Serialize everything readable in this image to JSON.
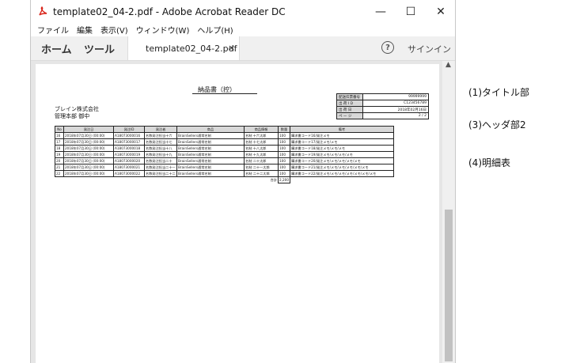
{
  "window": {
    "title": "template02_04-2.pdf - Adobe Acrobat Reader DC",
    "minimize": "—",
    "maximize": "☐",
    "close": "✕"
  },
  "menu": [
    "ファイル",
    "編集",
    "表示(V)",
    "ウィンドウ(W)",
    "ヘルプ(H)"
  ],
  "toolbar": {
    "home": "ホーム",
    "tools": "ツール",
    "tab_label": "template02_04-2.pdf",
    "tab_close": "×",
    "help": "?",
    "signin": "サインイン"
  },
  "scrollbar": {
    "up": "▲"
  },
  "document": {
    "title": "納品書（控）",
    "company": "ブレイン株式会社",
    "department": "管理本部 御中",
    "info": [
      {
        "label": "配送伝票番号",
        "value": "99999999"
      },
      {
        "label": "出 荷 I D",
        "value": "C123456789"
      },
      {
        "label": "出 荷 日",
        "value": "2018年02月16日"
      },
      {
        "label": "ペ ー ジ",
        "value": "2 / 2"
      }
    ],
    "columns": [
      "No",
      "発注日",
      "発注ID",
      "発注者",
      "商品",
      "商品情報",
      "数量",
      "備考"
    ],
    "rows": [
      [
        "16",
        "2018年07月30日 (00:00)",
        "A18073000016",
        "名数発注担当十六",
        "BrainSellers通常名制",
        "名制 十六太郎",
        "100",
        "購求書コード16/発注メモ"
      ],
      [
        "17",
        "2018年07月30日 (00:00)",
        "A18073000017",
        "名数発注担当十七",
        "BrainSellers通常名制",
        "名制 十七太郎",
        "100",
        "購求書コード17/発注メモ/メモ"
      ],
      [
        "18",
        "2018年07月30日 (00:00)",
        "A18073000018",
        "名数発注担当十八",
        "BrainSellers通常名制",
        "名制 十八太郎",
        "100",
        "購求書コード18/発注メモ/メモ/メモ"
      ],
      [
        "19",
        "2018年07月30日 (00:00)",
        "A18073000019",
        "名数発注担当十九",
        "BrainSellers通常名制",
        "名制 十九太郎",
        "100",
        "購求書コード19/発注メモ/メモ/メモ/メモ"
      ],
      [
        "20",
        "2018年07月30日 (00:00)",
        "A18073000020",
        "名数発注担当二十",
        "BrainSellers通常名制",
        "名制 二十太郎",
        "100",
        "購求書コード20/発注メモ/メモ/メモ/メモ/メモ"
      ],
      [
        "21",
        "2018年07月30日 (00:00)",
        "A18073000021",
        "名数発注担当二十一",
        "BrainSellers通常名制",
        "名制 二十一太郎",
        "100",
        "購求書コード21/発注メモ/メモ/メモ/メモ/メモ/メモ"
      ],
      [
        "22",
        "2018年07月30日 (00:00)",
        "A18073000022",
        "名数発注担当二十二",
        "BrainSellers通常名制",
        "名制 二十二太郎",
        "100",
        "購求書コード22/発注メモ/メモ/メモ/メモ/メモ/メモ/メモ"
      ]
    ],
    "total_label": "合計",
    "total_value": "2,200"
  },
  "annotations": [
    "(1)タイトル部",
    "(3)ヘッダ部2",
    "(4)明細表"
  ]
}
